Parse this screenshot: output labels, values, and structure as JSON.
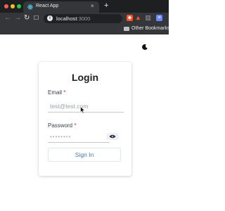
{
  "browser": {
    "tab": {
      "title": "React App",
      "close_glyph": "×",
      "favicon": "react-icon"
    },
    "new_tab_glyph": "+",
    "nav": {
      "back": "←",
      "forward": "→",
      "reload": "↻",
      "bookmark": "☐"
    },
    "url": {
      "host": "localhost",
      "port": ":3000"
    },
    "bookmarks_bar": {
      "label": "Other Bookmarks"
    }
  },
  "page": {
    "theme_toggle_icon": "moon-icon",
    "login": {
      "title": "Login",
      "email": {
        "label": "Email",
        "required_marker": "*",
        "placeholder": "test@test.com",
        "value": ""
      },
      "password": {
        "label": "Password",
        "required_marker": "*",
        "placeholder": "••••••••",
        "value": ""
      },
      "submit_label": "Sign In"
    }
  },
  "colors": {
    "chrome_bg": "#35363a",
    "accent": "#3a7dbf",
    "required": "#d93025"
  }
}
